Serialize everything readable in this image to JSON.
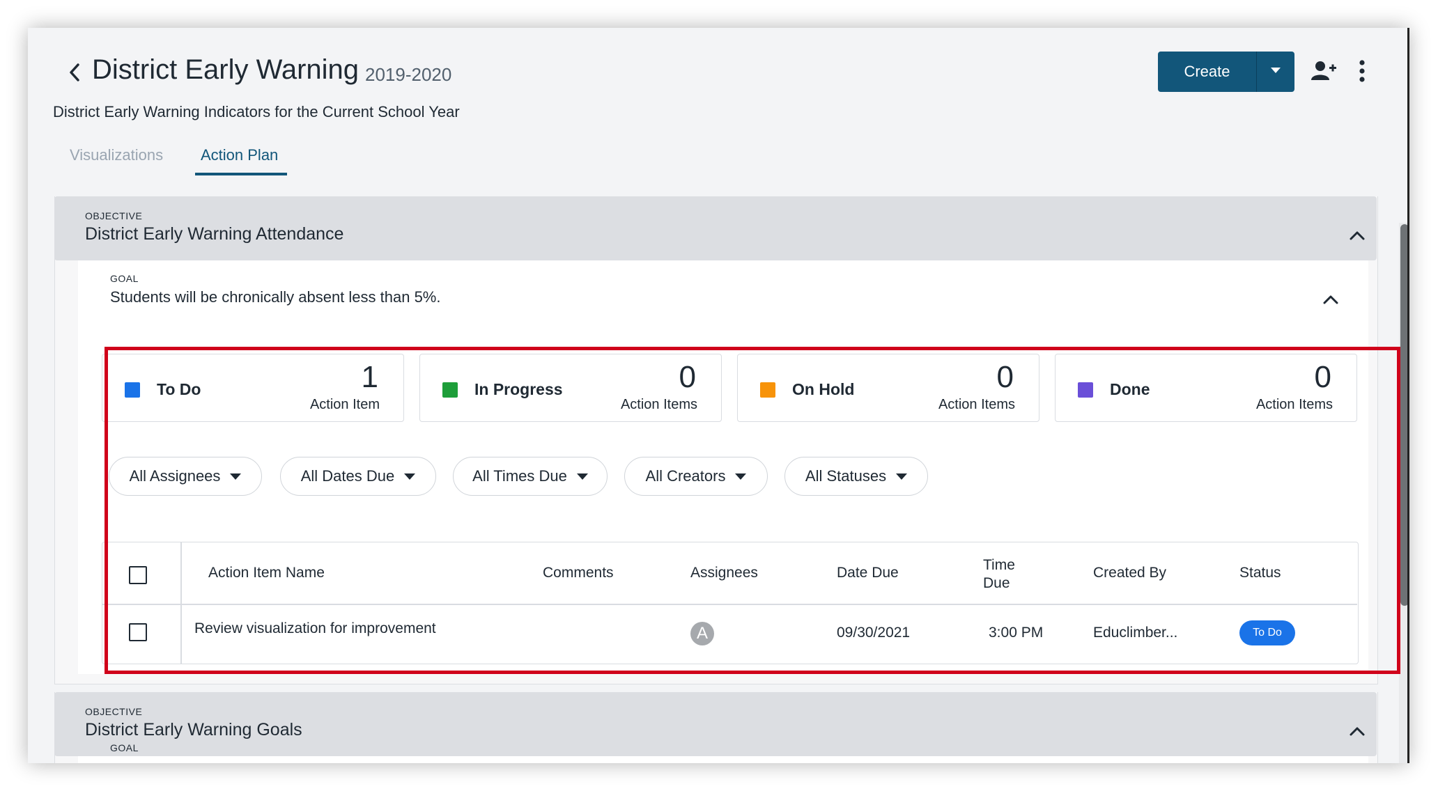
{
  "header": {
    "title": "District Early Warning",
    "year": "2019-2020",
    "subtitle": "District Early Warning Indicators for the Current School Year",
    "create_label": "Create"
  },
  "tabs": [
    {
      "label": "Visualizations",
      "active": false
    },
    {
      "label": "Action Plan",
      "active": true
    }
  ],
  "objectives": [
    {
      "label": "OBJECTIVE",
      "title": "District Early Warning Attendance",
      "goal": {
        "label": "GOAL",
        "text": "Students will be chronically absent less than 5%."
      }
    },
    {
      "label": "OBJECTIVE",
      "title": "District Early Warning Goals",
      "goal": {
        "label": "GOAL",
        "text": ""
      }
    }
  ],
  "status_cards": [
    {
      "label": "To Do",
      "count": "1",
      "sub": "Action Item",
      "color": "#1a73e8"
    },
    {
      "label": "In Progress",
      "count": "0",
      "sub": "Action Items",
      "color": "#1e9e3a"
    },
    {
      "label": "On Hold",
      "count": "0",
      "sub": "Action Items",
      "color": "#f7930a"
    },
    {
      "label": "Done",
      "count": "0",
      "sub": "Action Items",
      "color": "#6a4fd8"
    }
  ],
  "filters": [
    {
      "label": "All Assignees"
    },
    {
      "label": "All Dates Due"
    },
    {
      "label": "All Times Due"
    },
    {
      "label": "All Creators"
    },
    {
      "label": "All Statuses"
    }
  ],
  "table": {
    "headers": {
      "name": "Action Item Name",
      "comments": "Comments",
      "assignees": "Assignees",
      "date_due": "Date Due",
      "time_due_1": "Time",
      "time_due_2": "Due",
      "created_by": "Created By",
      "status": "Status"
    },
    "rows": [
      {
        "name": "Review visualization for improvement",
        "comments": "",
        "assignee_initial": "A",
        "date_due": "09/30/2021",
        "time_due": "3:00 PM",
        "created_by": "Educlimber...",
        "status": "To Do"
      }
    ]
  },
  "icons": {
    "back": "chevron-left-icon",
    "create_dropdown": "caret-down-icon",
    "add_user": "add-user-icon",
    "more": "kebab-menu-icon",
    "collapse": "chevron-up-icon"
  },
  "colors": {
    "primary": "#12567a",
    "highlight": "#d0021b",
    "status_todo_badge": "#1a73e8"
  }
}
